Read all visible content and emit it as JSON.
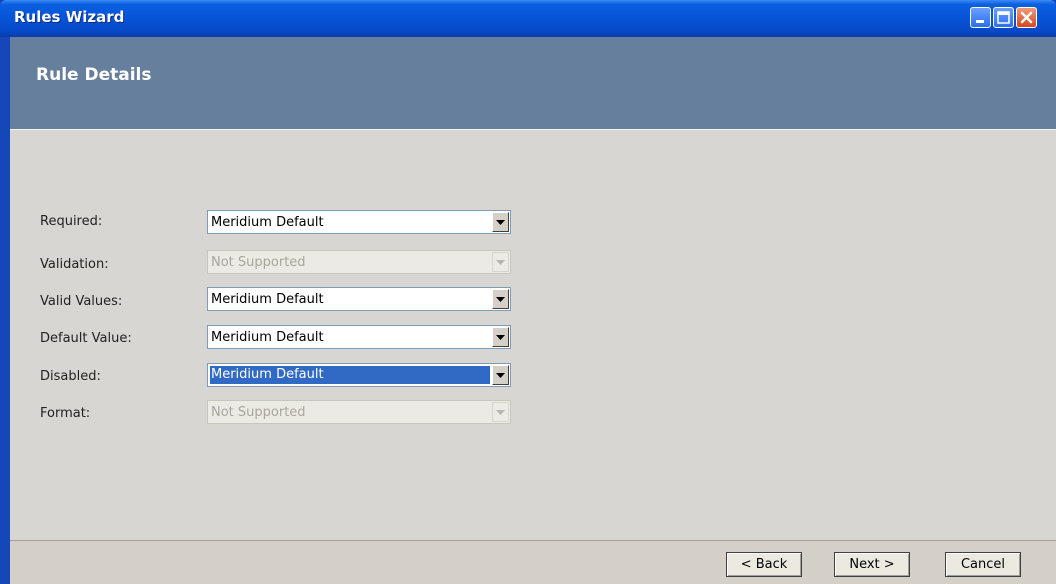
{
  "window": {
    "title": "Rules Wizard",
    "controls": [
      "minimize-icon",
      "maximize-icon",
      "close-icon"
    ]
  },
  "header": {
    "title": "Rule Details"
  },
  "form": {
    "rows": [
      {
        "label": "Required:",
        "value": "Meridium Default",
        "enabled": true,
        "selected": false
      },
      {
        "label": "Validation:",
        "value": "Not Supported",
        "enabled": false,
        "selected": false
      },
      {
        "label": "Valid Values:",
        "value": "Meridium Default",
        "enabled": true,
        "selected": false
      },
      {
        "label": "Default Value:",
        "value": "Meridium Default",
        "enabled": true,
        "selected": false
      },
      {
        "label": "Disabled:",
        "value": "Meridium Default",
        "enabled": true,
        "selected": true
      },
      {
        "label": "Format:",
        "value": "Not Supported",
        "enabled": false,
        "selected": false
      }
    ]
  },
  "footer": {
    "back_label": "< Back",
    "next_label": "Next >",
    "cancel_label": "Cancel"
  },
  "colors": {
    "titlebar": "#0554d6",
    "header_band": "#667f9c",
    "body": "#d7d6d3",
    "selection": "#316ac5"
  }
}
